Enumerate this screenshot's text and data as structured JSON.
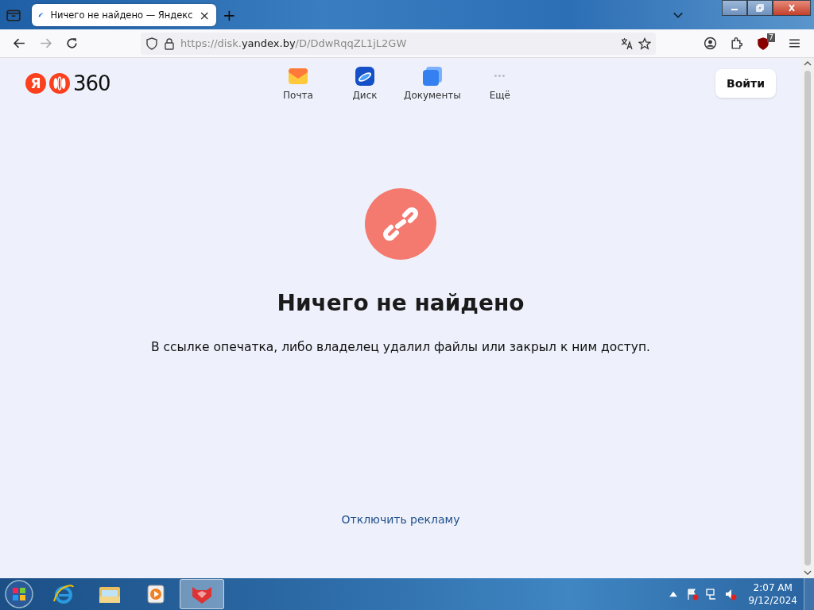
{
  "browser": {
    "tab": {
      "title": "Ничего не найдено — Яндекс",
      "close": "×",
      "selected": true
    },
    "new_tab": "+",
    "url": {
      "prefix": "https://disk.",
      "domain": "yandex.by",
      "path": "/D/DdwRqqZL1jL2GW"
    },
    "extension_badge": "7"
  },
  "page": {
    "logo": {
      "letter": "Я",
      "number": "360"
    },
    "services": [
      {
        "label": "Почта",
        "kind": "mail"
      },
      {
        "label": "Диск",
        "kind": "disk"
      },
      {
        "label": "Документы",
        "kind": "docs"
      },
      {
        "label": "Ещё",
        "kind": "more"
      }
    ],
    "login_button": "Войти",
    "title": "Ничего не найдено",
    "message": "В ссылке опечатка, либо владелец удалил файлы или закрыл к ним доступ.",
    "link": "Отключить рекламу"
  },
  "taskbar": {
    "apps": [
      {
        "kind": "ie",
        "selected": false
      },
      {
        "kind": "explorer",
        "selected": false
      },
      {
        "kind": "media",
        "selected": false
      },
      {
        "kind": "browser",
        "selected": true
      }
    ],
    "time": "2:07 AM",
    "date": "9/12/2024"
  }
}
